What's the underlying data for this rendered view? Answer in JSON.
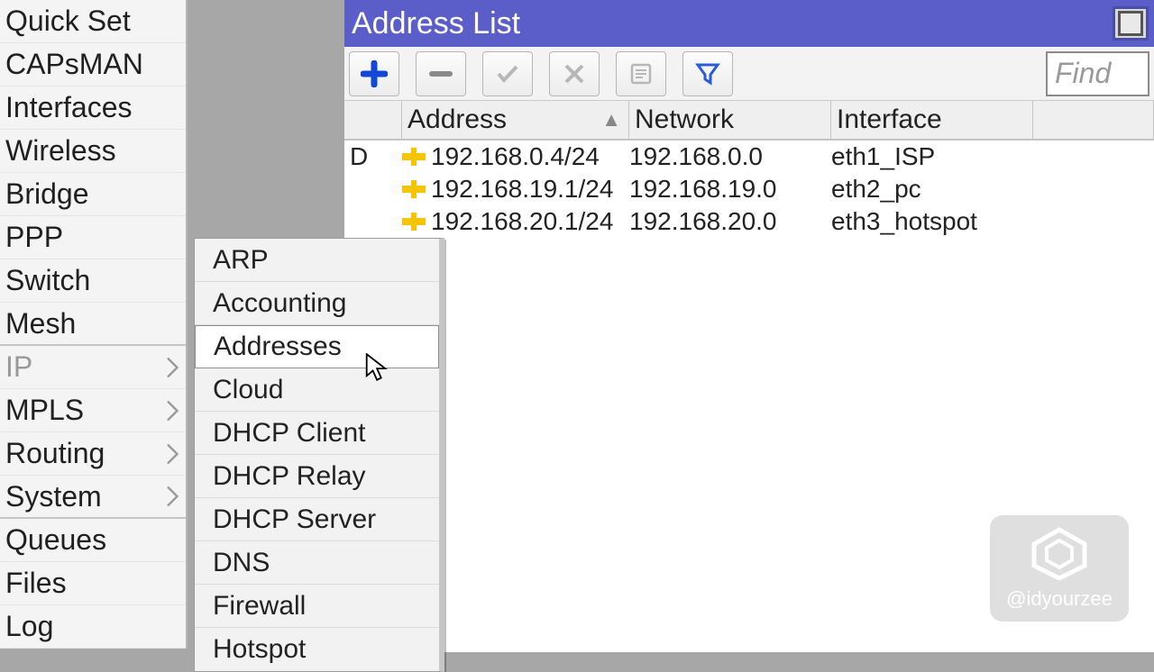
{
  "sidebar": {
    "items": [
      {
        "label": "Quick Set",
        "submenu": false
      },
      {
        "label": "CAPsMAN",
        "submenu": false
      },
      {
        "label": "Interfaces",
        "submenu": false
      },
      {
        "label": "Wireless",
        "submenu": false
      },
      {
        "label": "Bridge",
        "submenu": false
      },
      {
        "label": "PPP",
        "submenu": false
      },
      {
        "label": "Switch",
        "submenu": false
      },
      {
        "label": "Mesh",
        "submenu": false
      },
      {
        "label": "IP",
        "submenu": true,
        "active": true
      },
      {
        "label": "MPLS",
        "submenu": true
      },
      {
        "label": "Routing",
        "submenu": true
      },
      {
        "label": "System",
        "submenu": true
      },
      {
        "label": "Queues",
        "submenu": false
      },
      {
        "label": "Files",
        "submenu": false
      },
      {
        "label": "Log",
        "submenu": false
      }
    ]
  },
  "submenu": {
    "parent": "IP",
    "hovered": "Addresses",
    "items": [
      "ARP",
      "Accounting",
      "Addresses",
      "Cloud",
      "DHCP Client",
      "DHCP Relay",
      "DHCP Server",
      "DNS",
      "Firewall",
      "Hotspot"
    ]
  },
  "window": {
    "title": "Address List",
    "find_placeholder": "Find",
    "toolbar_icons": [
      "plus-icon",
      "minus-icon",
      "check-icon",
      "x-icon",
      "note-icon",
      "funnel-icon"
    ],
    "columns": [
      "",
      "Address",
      "Network",
      "Interface",
      ""
    ],
    "sort_column": "Address",
    "rows": [
      {
        "flag": "D",
        "address": "192.168.0.4/24",
        "network": "192.168.0.0",
        "interface": "eth1_ISP"
      },
      {
        "flag": "",
        "address": "192.168.19.1/24",
        "network": "192.168.19.0",
        "interface": "eth2_pc"
      },
      {
        "flag": "",
        "address": "192.168.20.1/24",
        "network": "192.168.20.0",
        "interface": "eth3_hotspot"
      }
    ]
  },
  "watermark": {
    "handle": "@idyourzee"
  }
}
